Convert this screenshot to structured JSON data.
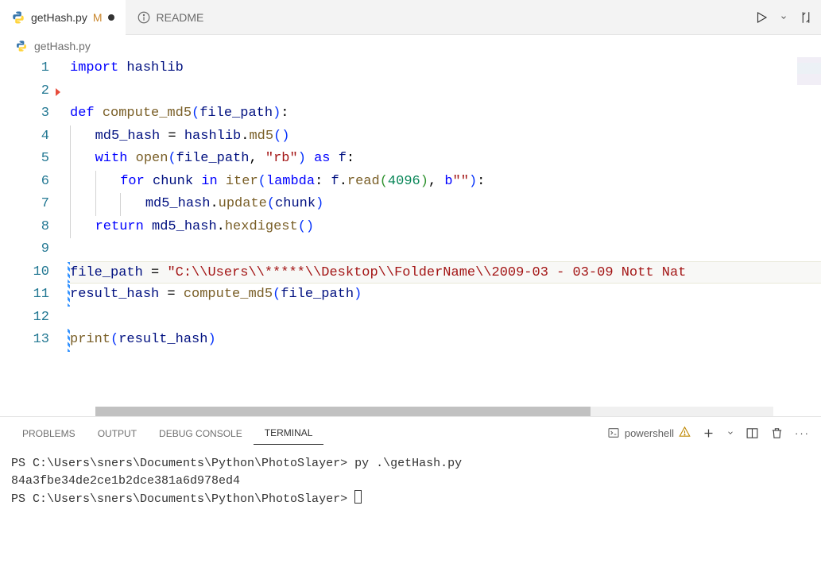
{
  "tabs": [
    {
      "name": "getHash.py",
      "modified_marker": "M",
      "dirty": true,
      "active": true
    },
    {
      "name": "README",
      "icon": "info",
      "active": false
    }
  ],
  "breadcrumb": {
    "file": "getHash.py"
  },
  "code": {
    "lines": [
      {
        "n": 1,
        "tokens": [
          [
            "kw",
            "import"
          ],
          [
            "",
            ""
          ],
          [
            "var",
            " hashlib"
          ]
        ]
      },
      {
        "n": 2,
        "tokens": [],
        "bp": true
      },
      {
        "n": 3,
        "tokens": [
          [
            "kw",
            "def "
          ],
          [
            "fn",
            "compute_md5"
          ],
          [
            "paren",
            "("
          ],
          [
            "var",
            "file_path"
          ],
          [
            "paren",
            ")"
          ],
          [
            "op",
            ":"
          ]
        ]
      },
      {
        "n": 4,
        "tokens": [
          [
            "",
            "    "
          ],
          [
            "var",
            "md5_hash"
          ],
          [
            "op",
            " = "
          ],
          [
            "var",
            "hashlib"
          ],
          [
            "op",
            "."
          ],
          [
            "fn",
            "md5"
          ],
          [
            "paren",
            "("
          ],
          [
            "paren",
            ")"
          ]
        ]
      },
      {
        "n": 5,
        "tokens": [
          [
            "",
            "    "
          ],
          [
            "kw",
            "with"
          ],
          [
            "",
            " "
          ],
          [
            "fn",
            "open"
          ],
          [
            "paren",
            "("
          ],
          [
            "var",
            "file_path"
          ],
          [
            "op",
            ", "
          ],
          [
            "str",
            "\"rb\""
          ],
          [
            "paren",
            ")"
          ],
          [
            "",
            " "
          ],
          [
            "kw",
            "as"
          ],
          [
            "",
            " "
          ],
          [
            "var",
            "f"
          ],
          [
            "op",
            ":"
          ]
        ]
      },
      {
        "n": 6,
        "tokens": [
          [
            "",
            "        "
          ],
          [
            "kw",
            "for"
          ],
          [
            "",
            " "
          ],
          [
            "var",
            "chunk"
          ],
          [
            "",
            " "
          ],
          [
            "kw",
            "in"
          ],
          [
            "",
            " "
          ],
          [
            "fn",
            "iter"
          ],
          [
            "paren",
            "("
          ],
          [
            "kw",
            "lambda"
          ],
          [
            "op",
            ": "
          ],
          [
            "var",
            "f"
          ],
          [
            "op",
            "."
          ],
          [
            "fn",
            "read"
          ],
          [
            "paren2",
            "("
          ],
          [
            "num",
            "4096"
          ],
          [
            "paren2",
            ")"
          ],
          [
            "op",
            ", "
          ],
          [
            "const",
            "b"
          ],
          [
            "str",
            "\"\""
          ],
          [
            "paren",
            ")"
          ],
          [
            "op",
            ":"
          ]
        ]
      },
      {
        "n": 7,
        "tokens": [
          [
            "",
            "            "
          ],
          [
            "var",
            "md5_hash"
          ],
          [
            "op",
            "."
          ],
          [
            "fn",
            "update"
          ],
          [
            "paren",
            "("
          ],
          [
            "var",
            "chunk"
          ],
          [
            "paren",
            ")"
          ]
        ]
      },
      {
        "n": 8,
        "tokens": [
          [
            "",
            "    "
          ],
          [
            "kw",
            "return"
          ],
          [
            "",
            " "
          ],
          [
            "var",
            "md5_hash"
          ],
          [
            "op",
            "."
          ],
          [
            "fn",
            "hexdigest"
          ],
          [
            "paren",
            "("
          ],
          [
            "paren",
            ")"
          ]
        ]
      },
      {
        "n": 9,
        "tokens": []
      },
      {
        "n": 10,
        "highlight": true,
        "mod": true,
        "tokens": [
          [
            "var",
            "file_path"
          ],
          [
            "op",
            " = "
          ],
          [
            "str",
            "\"C:\\\\Users\\\\*****\\\\Desktop\\\\FolderName\\\\2009-03 - 03-09 Nott Nat"
          ]
        ]
      },
      {
        "n": 11,
        "mod": true,
        "tokens": [
          [
            "var",
            "result_hash"
          ],
          [
            "op",
            " = "
          ],
          [
            "fn",
            "compute_md5"
          ],
          [
            "paren",
            "("
          ],
          [
            "var",
            "file_path"
          ],
          [
            "paren",
            ")"
          ]
        ]
      },
      {
        "n": 12,
        "tokens": []
      },
      {
        "n": 13,
        "mod": true,
        "tokens": [
          [
            "fn",
            "print"
          ],
          [
            "paren",
            "("
          ],
          [
            "var",
            "result_hash"
          ],
          [
            "paren",
            ")"
          ]
        ]
      }
    ]
  },
  "panel": {
    "tabs": [
      "PROBLEMS",
      "OUTPUT",
      "DEBUG CONSOLE",
      "TERMINAL"
    ],
    "active": "TERMINAL",
    "shell": "powershell"
  },
  "terminal": {
    "lines": [
      "PS C:\\Users\\sners\\Documents\\Python\\PhotoSlayer> py .\\getHash.py",
      "84a3fbe34de2ce1b2dce381a6d978ed4",
      "PS C:\\Users\\sners\\Documents\\Python\\PhotoSlayer> "
    ]
  }
}
